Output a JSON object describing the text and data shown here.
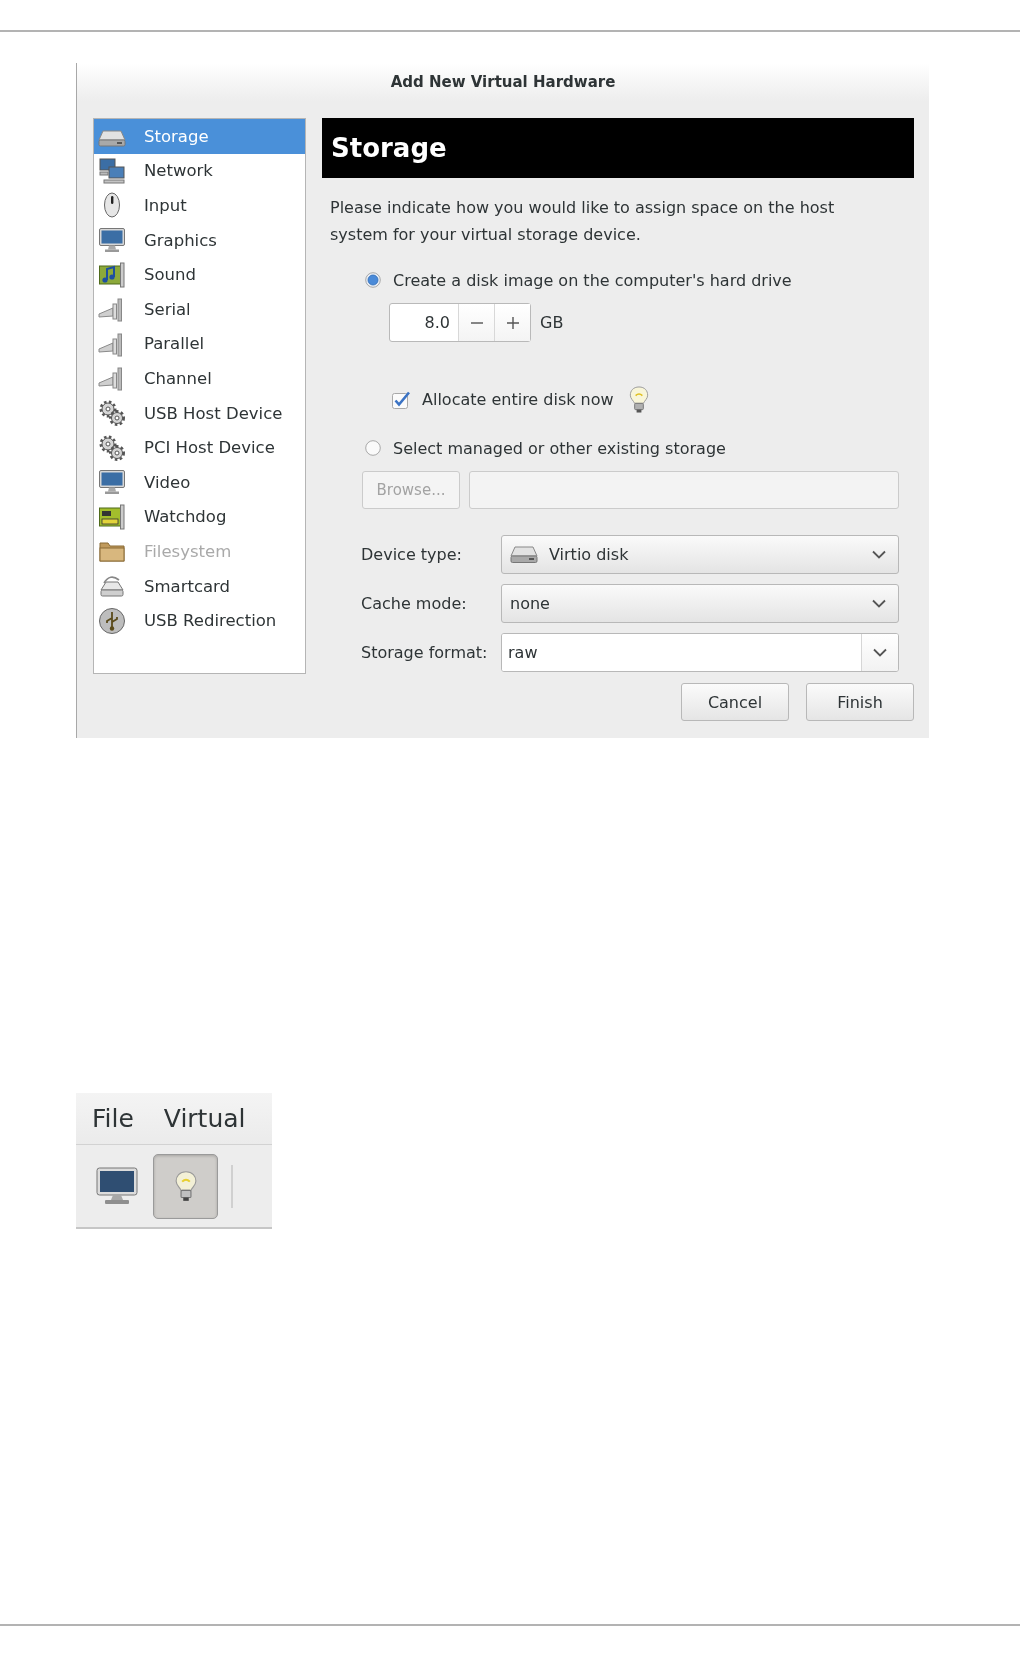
{
  "dialog": {
    "title": "Add New Virtual Hardware"
  },
  "sidebar": {
    "items": [
      {
        "label": "Storage",
        "kind": "disk",
        "selected": true,
        "disabled": false
      },
      {
        "label": "Network",
        "kind": "network",
        "selected": false,
        "disabled": false
      },
      {
        "label": "Input",
        "kind": "mouse",
        "selected": false,
        "disabled": false
      },
      {
        "label": "Graphics",
        "kind": "monitor",
        "selected": false,
        "disabled": false
      },
      {
        "label": "Sound",
        "kind": "soundcard",
        "selected": false,
        "disabled": false
      },
      {
        "label": "Serial",
        "kind": "plug",
        "selected": false,
        "disabled": false
      },
      {
        "label": "Parallel",
        "kind": "plug",
        "selected": false,
        "disabled": false
      },
      {
        "label": "Channel",
        "kind": "plug",
        "selected": false,
        "disabled": false
      },
      {
        "label": "USB Host Device",
        "kind": "gears",
        "selected": false,
        "disabled": false
      },
      {
        "label": "PCI Host Device",
        "kind": "gears",
        "selected": false,
        "disabled": false
      },
      {
        "label": "Video",
        "kind": "monitor",
        "selected": false,
        "disabled": false
      },
      {
        "label": "Watchdog",
        "kind": "board",
        "selected": false,
        "disabled": false
      },
      {
        "label": "Filesystem",
        "kind": "folder",
        "selected": false,
        "disabled": true
      },
      {
        "label": "Smartcard",
        "kind": "reader",
        "selected": false,
        "disabled": false
      },
      {
        "label": "USB Redirection",
        "kind": "usb",
        "selected": false,
        "disabled": false
      }
    ]
  },
  "page": {
    "heading": "Storage",
    "description": "Please indicate how you would like to assign space on the host system for your virtual storage device.",
    "disk_options": [
      {
        "kind": "create",
        "label": "Create a disk image on the computer's hard drive",
        "selected": true,
        "size": {
          "value": "8.0",
          "unit": "GB"
        },
        "allocate": {
          "label": "Allocate entire disk now",
          "checked": true
        }
      },
      {
        "kind": "existing",
        "label": "Select managed or other existing storage",
        "selected": false,
        "browse": {
          "label": "Browse...",
          "disabled": true
        }
      }
    ],
    "fields": [
      {
        "kind": "icon_combo",
        "label": "Device type:",
        "value": "Virtio disk"
      },
      {
        "kind": "combo",
        "label": "Cache mode:",
        "value": "none"
      },
      {
        "kind": "entry_combo",
        "label": "Storage format:",
        "value": "raw"
      }
    ],
    "buttons": [
      {
        "label": "Cancel"
      },
      {
        "label": "Finish"
      }
    ]
  },
  "manager_window": {
    "menu": [
      {
        "label": "File"
      },
      {
        "label": "Virtual"
      }
    ],
    "toolbar": [
      {
        "kind": "console",
        "selected": false
      },
      {
        "kind": "details",
        "selected": true
      }
    ]
  }
}
